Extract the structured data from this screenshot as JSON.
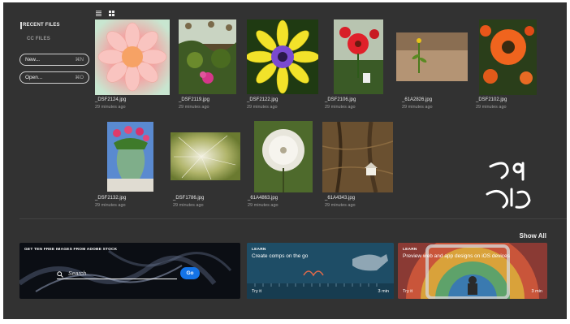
{
  "sidebar": {
    "recent_files": "RECENT FILES",
    "cc_files": "CC FILES",
    "new_label": "New...",
    "new_shortcut": "⌘N",
    "open_label": "Open...",
    "open_shortcut": "⌘O"
  },
  "view_toggle": {
    "list_icon": "list-view-icon",
    "grid_icon": "grid-view-icon"
  },
  "files": [
    {
      "name": "_DSF2124.jpg",
      "time": "29 minutes ago"
    },
    {
      "name": "_DSF2119.jpg",
      "time": "29 minutes ago"
    },
    {
      "name": "_DSF2122.jpg",
      "time": "29 minutes ago"
    },
    {
      "name": "_DSF2106.jpg",
      "time": "29 minutes ago"
    },
    {
      "name": "_61A2826.jpg",
      "time": "29 minutes ago"
    },
    {
      "name": "_DSF2102.jpg",
      "time": "29 minutes ago"
    },
    {
      "name": "_DSF2132.jpg",
      "time": "29 minutes ago"
    },
    {
      "name": "_DSF1786.jpg",
      "time": "29 minutes ago"
    },
    {
      "name": "_61A4863.jpg",
      "time": "29 minutes ago"
    },
    {
      "name": "_61A4343.jpg",
      "time": "29 minutes ago"
    }
  ],
  "show_all": "Show All",
  "stock_card": {
    "title": "GET TEN FREE IMAGES FROM ADOBE STOCK",
    "search_placeholder": "Search",
    "go_label": "Go"
  },
  "learn_cards": [
    {
      "tag": "LEARN",
      "title": "Create comps on the go",
      "try_label": "Try it",
      "duration": "3 min"
    },
    {
      "tag": "LEARN",
      "title": "Preview web and app designs on iOS devices",
      "try_label": "Try it",
      "duration": "3 min"
    }
  ],
  "colors": {
    "panel_bg": "#323232",
    "accent_blue": "#1473e6"
  }
}
